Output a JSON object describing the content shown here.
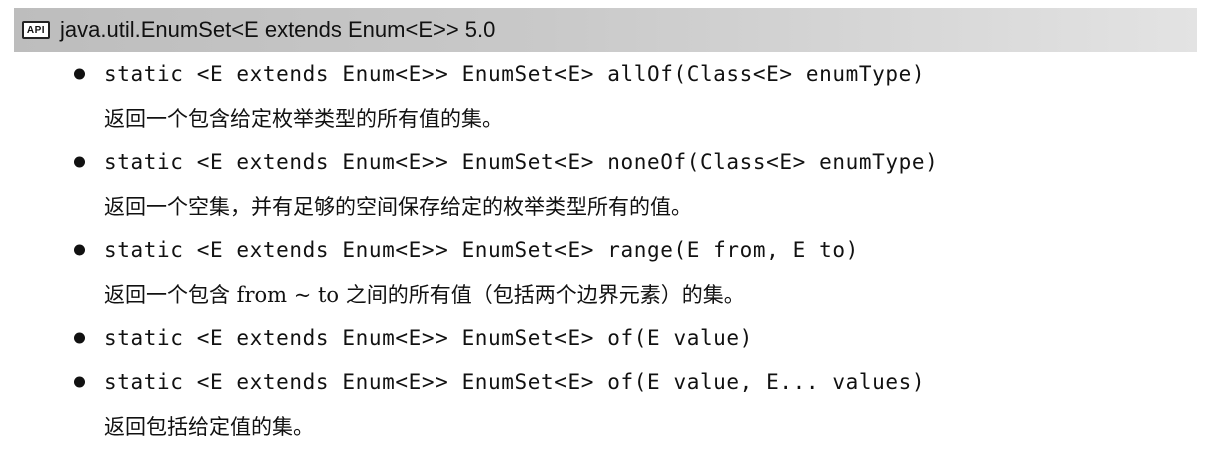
{
  "header": {
    "badge": "API",
    "title": "java.util.EnumSet<E extends Enum<E>> 5.0"
  },
  "methods": [
    {
      "signature": "static <E extends Enum<E>> EnumSet<E> allOf(Class<E> enumType)",
      "description": "返回一个包含给定枚举类型的所有值的集。"
    },
    {
      "signature": "static <E extends Enum<E>> EnumSet<E> noneOf(Class<E> enumType)",
      "description": "返回一个空集，并有足够的空间保存给定的枚举类型所有的值。"
    },
    {
      "signature": "static <E extends Enum<E>> EnumSet<E> range(E from, E to)",
      "description": "返回一个包含 from ~ to 之间的所有值（包括两个边界元素）的集。"
    },
    {
      "signature": "static <E extends Enum<E>> EnumSet<E> of(E value)",
      "description": ""
    },
    {
      "signature": "static <E extends Enum<E>> EnumSet<E> of(E value, E... values)",
      "description": "返回包括给定值的集。"
    }
  ]
}
